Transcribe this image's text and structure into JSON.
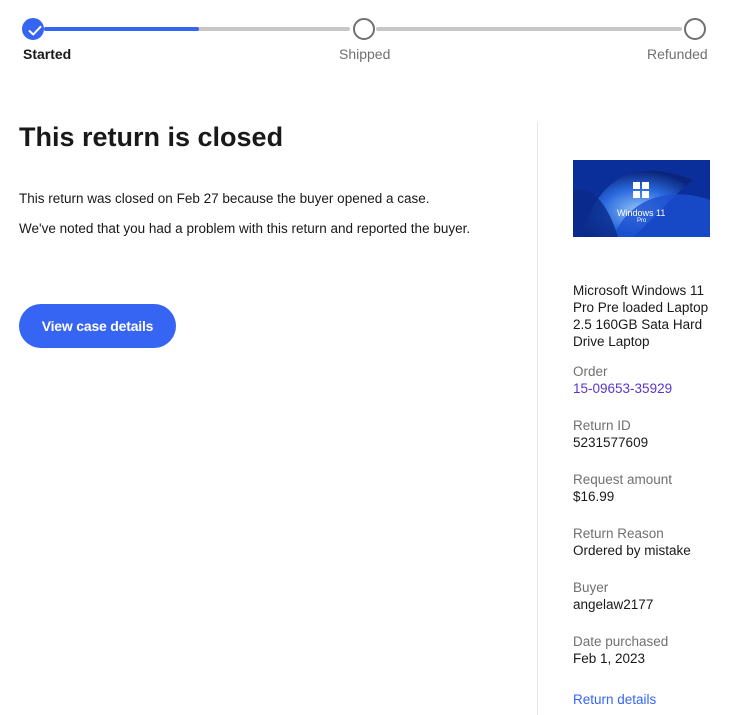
{
  "progress": {
    "steps": [
      {
        "label": "Started",
        "state": "complete"
      },
      {
        "label": "Shipped",
        "state": "pending"
      },
      {
        "label": "Refunded",
        "state": "pending"
      }
    ],
    "accent_color": "#3665f3"
  },
  "main": {
    "title": "This return is closed",
    "line1": "This return was closed on Feb 27 because the buyer opened a case.",
    "line2": "We've noted that you had a problem with this return and reported the buyer.",
    "button_label": "View case details"
  },
  "sidebar": {
    "thumbnail_text": "Windows 11",
    "thumbnail_subtext": "Pro",
    "item_title": "Microsoft Windows 11 Pro Pre loaded Laptop 2.5 160GB Sata Hard Drive Laptop",
    "order_label": "Order",
    "order_value": "15-09653-35929",
    "return_id_label": "Return ID",
    "return_id_value": "5231577609",
    "request_amount_label": "Request amount",
    "request_amount_value": "$16.99",
    "return_reason_label": "Return Reason",
    "return_reason_value": "Ordered by mistake",
    "buyer_label": "Buyer",
    "buyer_value": "angelaw2177",
    "date_label": "Date purchased",
    "date_value": "Feb 1, 2023",
    "return_details_link": "Return details"
  }
}
